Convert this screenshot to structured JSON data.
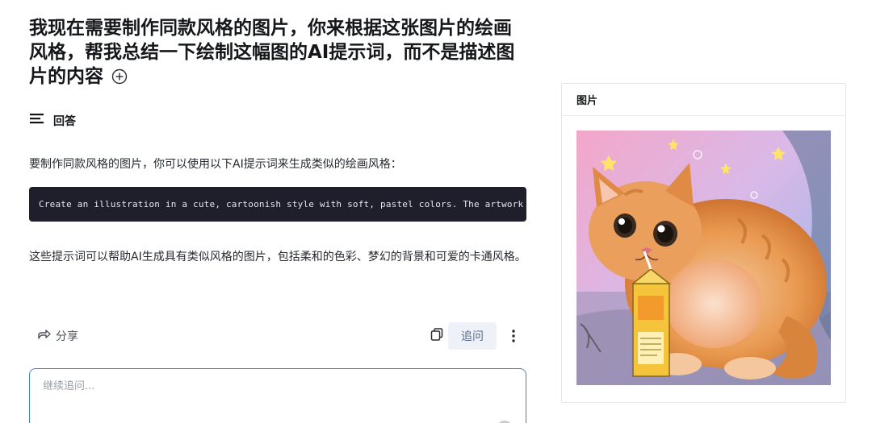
{
  "question": {
    "text": "我现在需要制作同款风格的图片，你来根据这张图片的绘画风格，帮我总结一下绘制这幅图的AI提示词，而不是描述图片的内容",
    "add_icon": "plus-circle-icon"
  },
  "answer": {
    "heading": "回答",
    "heading_icon": "align-left-icon",
    "intro": "要制作同款风格的图片，你可以使用以下AI提示词来生成类似的绘画风格：",
    "code": "Create an illustration in a cute, cartoonish style with soft, pastel colors. The artwork",
    "outro": "这些提示词可以帮助AI生成具有类似风格的图片，包括柔和的色彩、梦幻的背景和可爱的卡通风格。"
  },
  "actions": {
    "share_label": "分享",
    "share_icon": "share-arrow-icon",
    "copy_icon": "copy-icon",
    "followup_label": "追问",
    "more_icon": "more-vertical-icon"
  },
  "followup_input": {
    "placeholder": "继续追问..."
  },
  "image_panel": {
    "title": "图片",
    "image_subject": "orange-cat-drinking-juice-box-illustration"
  },
  "colors": {
    "accent": "#3b82d6",
    "code_bg": "#1e1f2b",
    "followup_bg": "#eef2f8"
  }
}
